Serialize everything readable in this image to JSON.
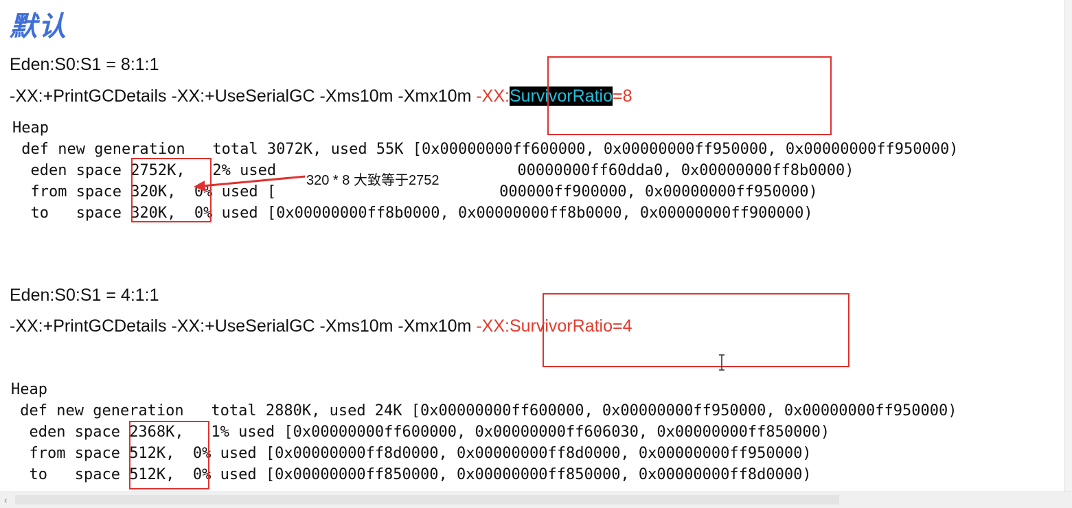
{
  "title": "默认",
  "section1": {
    "ratio": "Eden:S0:S1 = 8:1:1",
    "cmd_base": "-XX:+PrintGCDetails -XX:+UseSerialGC -Xms10m -Xmx10m ",
    "cmd_red_prefix": "-XX:",
    "cmd_highlight": "SurvivorRatio",
    "cmd_red_suffix": "=8",
    "heap": "Heap",
    "defnew": " def new generation   total 3072K, used 55K [0x00000000ff600000, 0x00000000ff950000, 0x00000000ff950000)",
    "eden_label": "  eden space ",
    "eden_size": "2752K,",
    "eden_rest": "   2% used ",
    "eden_tail": "00000000ff60dda0, 0x00000000ff8b0000)",
    "from_label": "  from space ",
    "from_size": "320K,",
    "from_rest": "  0% used [",
    "from_tail": "000000ff900000, 0x00000000ff950000)",
    "to_label": "  to   space ",
    "to_size": "320K,",
    "to_rest": "  0% used [0x00000000ff8b0000, 0x00000000ff8b0000, 0x00000000ff900000)",
    "annotation": "320 * 8 大致等于2752"
  },
  "section2": {
    "ratio": "Eden:S0:S1 = 4:1:1",
    "cmd_base": "-XX:+PrintGCDetails -XX:+UseSerialGC -Xms10m -Xmx10m ",
    "cmd_red": "-XX:SurvivorRatio=4",
    "heap": "Heap",
    "defnew": " def new generation   total 2880K, used 24K [0x00000000ff600000, 0x00000000ff950000, 0x00000000ff950000)",
    "eden_label": "  eden space ",
    "eden_size": "2368K,",
    "eden_rest": "   1% used [0x00000000ff600000, 0x00000000ff606030, 0x00000000ff850000)",
    "from_label": "  from space ",
    "from_size": "512K,",
    "from_rest": "  0% used [0x00000000ff8d0000, 0x00000000ff8d0000, 0x00000000ff950000)",
    "to_label": "  to   space ",
    "to_size": "512K,",
    "to_rest": "  0% used [0x00000000ff850000, 0x00000000ff850000, 0x00000000ff8d0000)"
  },
  "colors": {
    "red": "#e53a2c",
    "highlight_bg": "#000000",
    "highlight_fg": "#21c0dc",
    "title": "#3f6fd8"
  }
}
